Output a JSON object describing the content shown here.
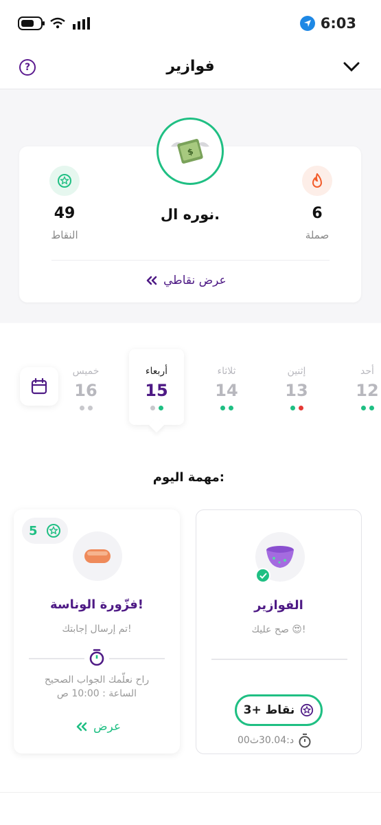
{
  "status_bar": {
    "time": "6:03"
  },
  "header": {
    "title": "فوازير",
    "help_icon": "question-circle-icon",
    "chevron_icon": "chevron-down-icon"
  },
  "profile": {
    "name": "نوره ال.",
    "streak": {
      "value": "6",
      "label": "صملة",
      "icon": "fire-icon"
    },
    "points": {
      "value": "49",
      "label": "النقاط",
      "icon": "star-icon"
    },
    "view_points": "عرض نقاطي",
    "avatar_icon": "flying-money-icon"
  },
  "week": {
    "days": [
      {
        "name": "أحد",
        "num": "12",
        "dots": [
          "#1fbf83",
          "#1fbf83"
        ]
      },
      {
        "name": "إثنين",
        "num": "13",
        "dots": [
          "#1fbf83",
          "#e53935"
        ]
      },
      {
        "name": "ثلاثاء",
        "num": "14",
        "dots": [
          "#1fbf83",
          "#1fbf83"
        ]
      },
      {
        "name": "أربعاء",
        "num": "15",
        "dots": [
          "#c8c8cc",
          "#1fbf83"
        ],
        "active": true
      },
      {
        "name": "خميس",
        "num": "16",
        "dots": [
          "#c8c8cc",
          "#c8c8cc"
        ]
      }
    ],
    "calendar_icon": "calendar-icon"
  },
  "tasks": {
    "title": "مهمة اليوم:",
    "card_main": {
      "name": "الفوازير",
      "sub": "صح عليك 😍!",
      "points": "3+ نقاط",
      "timer": "00د:30.04ث"
    },
    "card_secondary": {
      "name": "فزّورة الوناسة!",
      "sub": "تم إرسال إجابتك!",
      "badge": "5",
      "reveal_line1": "راح نعلّمك الجواب الصحيح",
      "reveal_line2": "الساعة : 10:00 ص",
      "view": "عرض"
    }
  },
  "colors": {
    "accent_green": "#1fbf83",
    "brand_purple": "#4e1a85",
    "fire_orange": "#f25c2a"
  }
}
